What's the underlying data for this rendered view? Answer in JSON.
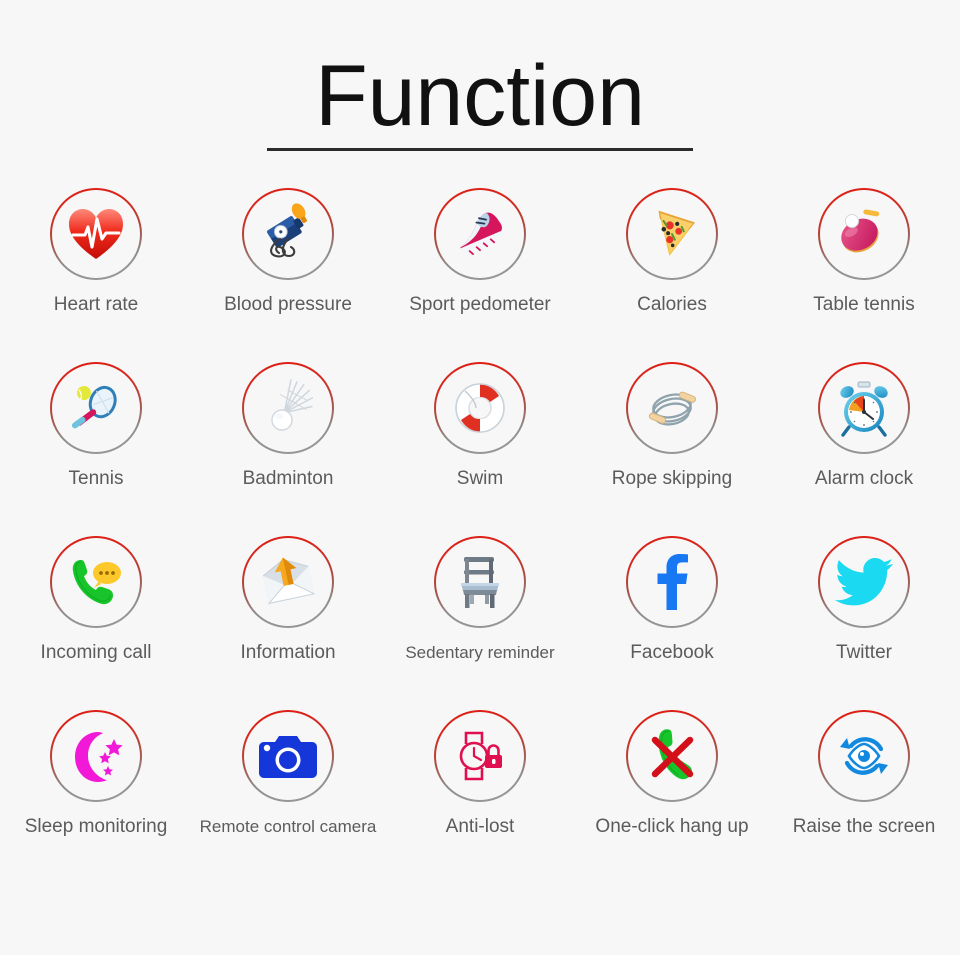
{
  "header": {
    "title": "Function"
  },
  "grid": {
    "rows": [
      [
        {
          "label": "Heart rate",
          "icon": "heart-rate-icon"
        },
        {
          "label": "Blood pressure",
          "icon": "blood-pressure-icon"
        },
        {
          "label": "Sport pedometer",
          "icon": "running-shoe-icon"
        },
        {
          "label": "Calories",
          "icon": "pizza-slice-icon"
        },
        {
          "label": "Table tennis",
          "icon": "table-tennis-paddle-icon"
        }
      ],
      [
        {
          "label": "Tennis",
          "icon": "tennis-racket-icon"
        },
        {
          "label": "Badminton",
          "icon": "shuttlecock-icon"
        },
        {
          "label": "Swim",
          "icon": "life-ring-icon"
        },
        {
          "label": "Rope skipping",
          "icon": "jump-rope-icon"
        },
        {
          "label": "Alarm clock",
          "icon": "alarm-clock-icon"
        }
      ],
      [
        {
          "label": "Incoming call",
          "icon": "phone-message-icon"
        },
        {
          "label": "Information",
          "icon": "envelope-arrow-icon"
        },
        {
          "label": "Sedentary reminder",
          "icon": "chair-icon"
        },
        {
          "label": "Facebook",
          "icon": "facebook-icon"
        },
        {
          "label": "Twitter",
          "icon": "twitter-bird-icon"
        }
      ],
      [
        {
          "label": "Sleep monitoring",
          "icon": "moon-stars-icon"
        },
        {
          "label": "Remote control camera",
          "icon": "camera-icon"
        },
        {
          "label": "Anti-lost",
          "icon": "watch-lock-icon"
        },
        {
          "label": "One-click hang up",
          "icon": "phone-cross-icon"
        },
        {
          "label": "Raise the screen",
          "icon": "eye-refresh-icon"
        }
      ]
    ]
  },
  "colors": {
    "background": "#f7f7f7",
    "ring_top": "#e01b10",
    "ring_bottom": "#9a9a9a",
    "label_text": "#5b5b5b",
    "title_text": "#111111",
    "facebook_blue": "#1877f2",
    "twitter_cyan": "#1ad9f0",
    "moon_magenta": "#f218d8",
    "camera_blue": "#1536d8",
    "watch_crimson": "#e01050",
    "phone_green": "#14cf2e",
    "eye_blue": "#1189e0"
  }
}
